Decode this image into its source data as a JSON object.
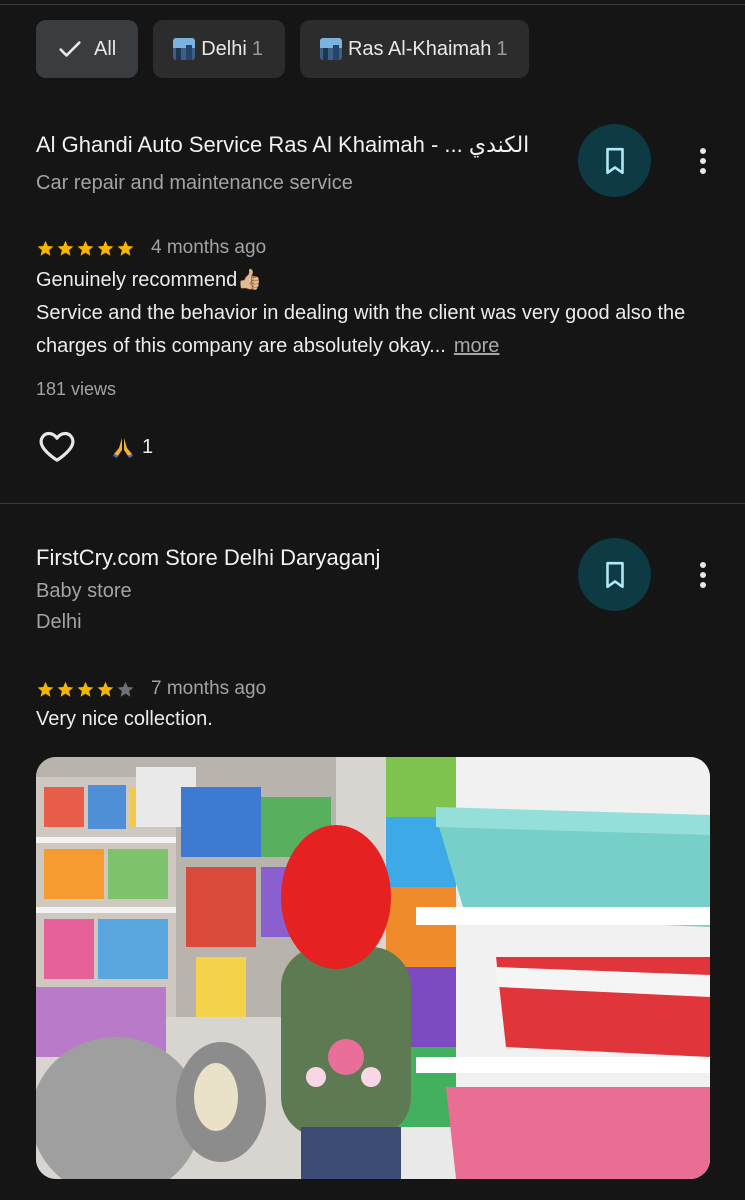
{
  "filters": [
    {
      "label": "All",
      "count": "",
      "selected": true,
      "icon": "check-icon"
    },
    {
      "label": "Delhi",
      "count": "1",
      "selected": false,
      "icon": "cityscape-icon"
    },
    {
      "label": "Ras Al-Khaimah",
      "count": "1",
      "selected": false,
      "icon": "cityscape-icon"
    }
  ],
  "reviews": [
    {
      "place_name": "Al Ghandi Auto Service Ras Al Khaimah - ... الكندي",
      "category": "Car repair and maintenance service",
      "location": "",
      "rating": 5,
      "time": "4 months ago",
      "text_line1": "Genuinely recommend👍🏼",
      "text_line2": "Service and the behavior in dealing with the client was very good also the charges of this company are absolutely okay...",
      "more_label": "more",
      "views": "181 views",
      "reaction_count": "1"
    },
    {
      "place_name": "FirstCry.com Store Delhi Daryaganj",
      "category": "Baby store",
      "location": "Delhi",
      "rating": 4,
      "time": "7 months ago",
      "text_line1": "Very nice collection."
    }
  ],
  "colors": {
    "background": "#151515",
    "star_filled": "#f4b400",
    "star_empty": "#6f6f6f",
    "save_button": "#0e3a43",
    "save_icon": "#aee9f5"
  }
}
